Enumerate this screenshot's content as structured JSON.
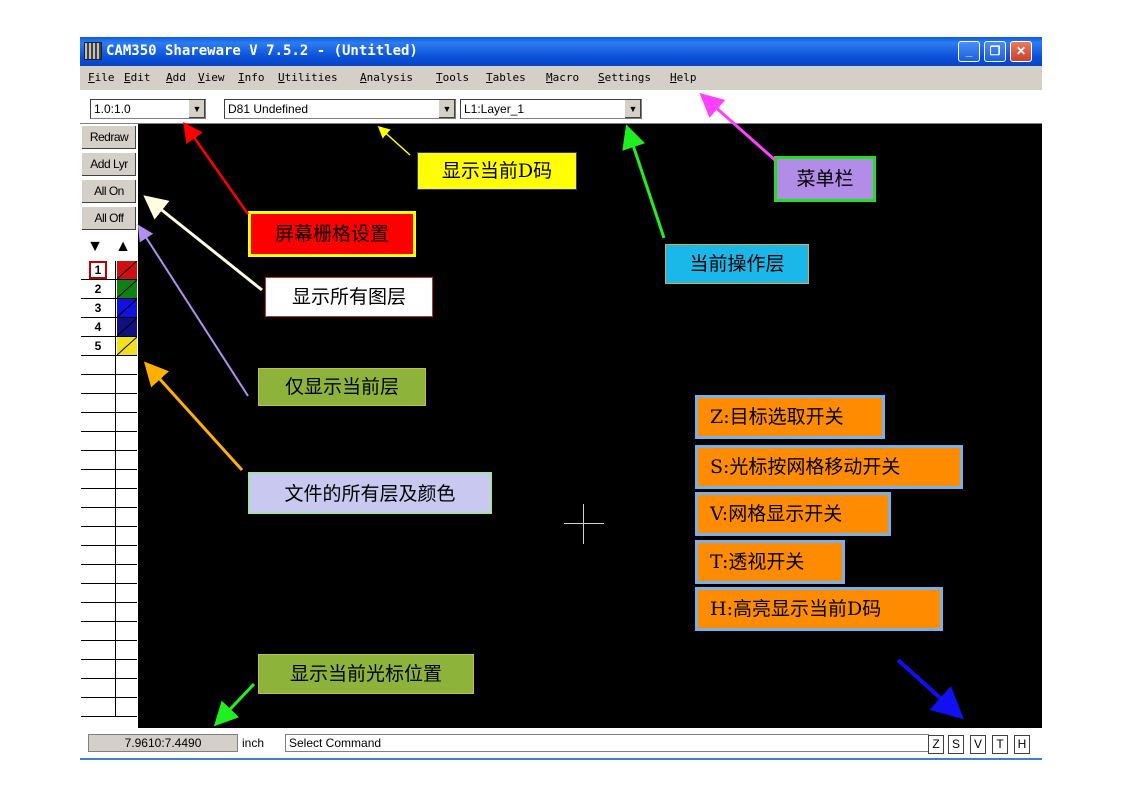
{
  "window": {
    "title": "CAM350 Shareware V 7.5.2 - (Untitled)",
    "controls": {
      "minimize": "_",
      "restore": "❐",
      "close": "✕"
    }
  },
  "menu": [
    "File",
    "Edit",
    "Add",
    "View",
    "Info",
    "Utilities",
    "Analysis",
    "Tools",
    "Tables",
    "Macro",
    "Settings",
    "Help"
  ],
  "toolbar": {
    "grid_value": "1.0:1.0",
    "dcode_value": "D81  Undefined",
    "layer_value": "L1:Layer_1"
  },
  "side_buttons": {
    "redraw": "Redraw",
    "add_layer": "Add Lyr",
    "all_on": "All On",
    "all_off": "All Off"
  },
  "layer_arrows": {
    "down": "▼",
    "up": "▲"
  },
  "layers": [
    {
      "num": "1",
      "color": "#d01010",
      "active": true
    },
    {
      "num": "2",
      "color": "#108010"
    },
    {
      "num": "3",
      "color": "#1010e0"
    },
    {
      "num": "4",
      "color": "#101080"
    },
    {
      "num": "5",
      "color": "#f0e020"
    }
  ],
  "status": {
    "coords": "7.9610:7.4490",
    "unit": "inch",
    "command": "Select Command",
    "toggles": [
      "Z",
      "S",
      "V",
      "T",
      "H"
    ]
  },
  "annotations": {
    "grid_setting": "屏幕栅格设置",
    "current_dcode": "显示当前D码",
    "menu_bar": "菜单栏",
    "current_layer": "当前操作层",
    "show_all_layers": "显示所有图层",
    "show_current_only": "仅显示当前层",
    "all_layers_colors": "文件的所有层及颜色",
    "cursor_position": "显示当前光标位置",
    "z_toggle": "Z:目标选取开关",
    "s_toggle": "S:光标按网格移动开关",
    "v_toggle": "V:网格显示开关",
    "t_toggle": "T:透视开关",
    "h_toggle": "H:高亮显示当前D码"
  },
  "colors": {
    "red": "#ff0000",
    "yellow": "#ffff00",
    "purple": "#b38ce8",
    "cyan": "#1ab8e8",
    "olive": "#8db33a",
    "lavender": "#c8c8f0",
    "orange": "#ff8c00"
  }
}
